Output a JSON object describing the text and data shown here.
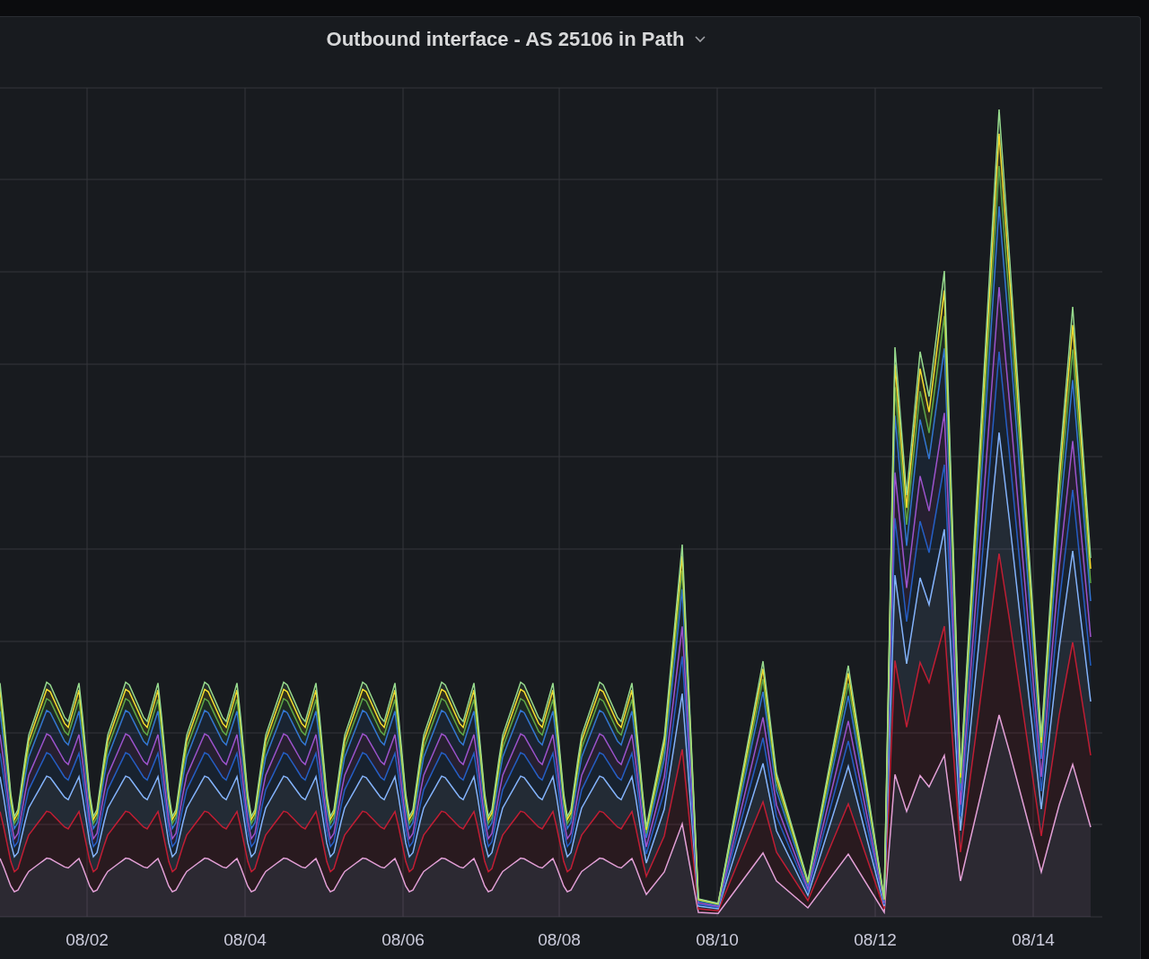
{
  "panel": {
    "title": "Outbound interface - AS 25106 in Path"
  },
  "x_axis": {
    "labels": [
      "08/02",
      "08/04",
      "08/06",
      "08/08",
      "08/10",
      "08/12",
      "08/14"
    ]
  }
}
